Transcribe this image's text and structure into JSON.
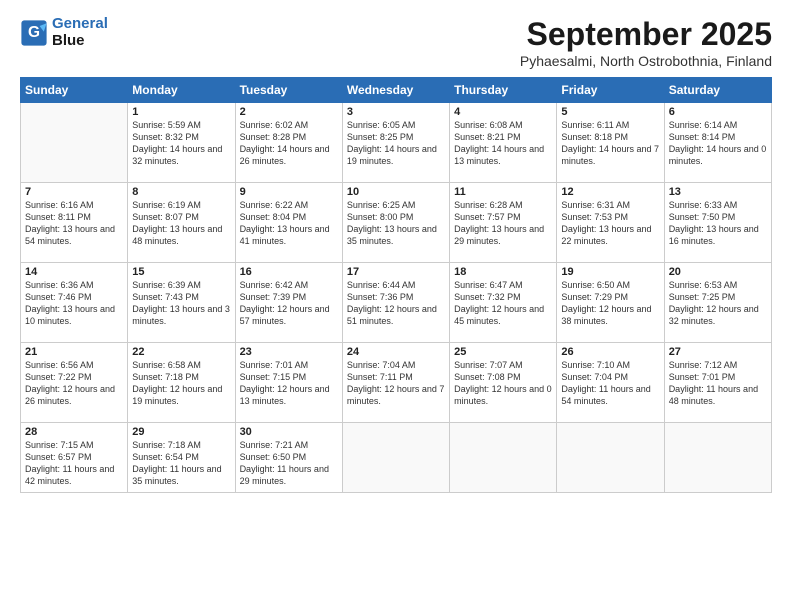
{
  "header": {
    "logo_line1": "General",
    "logo_line2": "Blue",
    "title": "September 2025",
    "subtitle": "Pyhaesalmi, North Ostrobothnia, Finland"
  },
  "days_of_week": [
    "Sunday",
    "Monday",
    "Tuesday",
    "Wednesday",
    "Thursday",
    "Friday",
    "Saturday"
  ],
  "weeks": [
    [
      {
        "num": "",
        "sunrise": "",
        "sunset": "",
        "daylight": ""
      },
      {
        "num": "1",
        "sunrise": "Sunrise: 5:59 AM",
        "sunset": "Sunset: 8:32 PM",
        "daylight": "Daylight: 14 hours and 32 minutes."
      },
      {
        "num": "2",
        "sunrise": "Sunrise: 6:02 AM",
        "sunset": "Sunset: 8:28 PM",
        "daylight": "Daylight: 14 hours and 26 minutes."
      },
      {
        "num": "3",
        "sunrise": "Sunrise: 6:05 AM",
        "sunset": "Sunset: 8:25 PM",
        "daylight": "Daylight: 14 hours and 19 minutes."
      },
      {
        "num": "4",
        "sunrise": "Sunrise: 6:08 AM",
        "sunset": "Sunset: 8:21 PM",
        "daylight": "Daylight: 14 hours and 13 minutes."
      },
      {
        "num": "5",
        "sunrise": "Sunrise: 6:11 AM",
        "sunset": "Sunset: 8:18 PM",
        "daylight": "Daylight: 14 hours and 7 minutes."
      },
      {
        "num": "6",
        "sunrise": "Sunrise: 6:14 AM",
        "sunset": "Sunset: 8:14 PM",
        "daylight": "Daylight: 14 hours and 0 minutes."
      }
    ],
    [
      {
        "num": "7",
        "sunrise": "Sunrise: 6:16 AM",
        "sunset": "Sunset: 8:11 PM",
        "daylight": "Daylight: 13 hours and 54 minutes."
      },
      {
        "num": "8",
        "sunrise": "Sunrise: 6:19 AM",
        "sunset": "Sunset: 8:07 PM",
        "daylight": "Daylight: 13 hours and 48 minutes."
      },
      {
        "num": "9",
        "sunrise": "Sunrise: 6:22 AM",
        "sunset": "Sunset: 8:04 PM",
        "daylight": "Daylight: 13 hours and 41 minutes."
      },
      {
        "num": "10",
        "sunrise": "Sunrise: 6:25 AM",
        "sunset": "Sunset: 8:00 PM",
        "daylight": "Daylight: 13 hours and 35 minutes."
      },
      {
        "num": "11",
        "sunrise": "Sunrise: 6:28 AM",
        "sunset": "Sunset: 7:57 PM",
        "daylight": "Daylight: 13 hours and 29 minutes."
      },
      {
        "num": "12",
        "sunrise": "Sunrise: 6:31 AM",
        "sunset": "Sunset: 7:53 PM",
        "daylight": "Daylight: 13 hours and 22 minutes."
      },
      {
        "num": "13",
        "sunrise": "Sunrise: 6:33 AM",
        "sunset": "Sunset: 7:50 PM",
        "daylight": "Daylight: 13 hours and 16 minutes."
      }
    ],
    [
      {
        "num": "14",
        "sunrise": "Sunrise: 6:36 AM",
        "sunset": "Sunset: 7:46 PM",
        "daylight": "Daylight: 13 hours and 10 minutes."
      },
      {
        "num": "15",
        "sunrise": "Sunrise: 6:39 AM",
        "sunset": "Sunset: 7:43 PM",
        "daylight": "Daylight: 13 hours and 3 minutes."
      },
      {
        "num": "16",
        "sunrise": "Sunrise: 6:42 AM",
        "sunset": "Sunset: 7:39 PM",
        "daylight": "Daylight: 12 hours and 57 minutes."
      },
      {
        "num": "17",
        "sunrise": "Sunrise: 6:44 AM",
        "sunset": "Sunset: 7:36 PM",
        "daylight": "Daylight: 12 hours and 51 minutes."
      },
      {
        "num": "18",
        "sunrise": "Sunrise: 6:47 AM",
        "sunset": "Sunset: 7:32 PM",
        "daylight": "Daylight: 12 hours and 45 minutes."
      },
      {
        "num": "19",
        "sunrise": "Sunrise: 6:50 AM",
        "sunset": "Sunset: 7:29 PM",
        "daylight": "Daylight: 12 hours and 38 minutes."
      },
      {
        "num": "20",
        "sunrise": "Sunrise: 6:53 AM",
        "sunset": "Sunset: 7:25 PM",
        "daylight": "Daylight: 12 hours and 32 minutes."
      }
    ],
    [
      {
        "num": "21",
        "sunrise": "Sunrise: 6:56 AM",
        "sunset": "Sunset: 7:22 PM",
        "daylight": "Daylight: 12 hours and 26 minutes."
      },
      {
        "num": "22",
        "sunrise": "Sunrise: 6:58 AM",
        "sunset": "Sunset: 7:18 PM",
        "daylight": "Daylight: 12 hours and 19 minutes."
      },
      {
        "num": "23",
        "sunrise": "Sunrise: 7:01 AM",
        "sunset": "Sunset: 7:15 PM",
        "daylight": "Daylight: 12 hours and 13 minutes."
      },
      {
        "num": "24",
        "sunrise": "Sunrise: 7:04 AM",
        "sunset": "Sunset: 7:11 PM",
        "daylight": "Daylight: 12 hours and 7 minutes."
      },
      {
        "num": "25",
        "sunrise": "Sunrise: 7:07 AM",
        "sunset": "Sunset: 7:08 PM",
        "daylight": "Daylight: 12 hours and 0 minutes."
      },
      {
        "num": "26",
        "sunrise": "Sunrise: 7:10 AM",
        "sunset": "Sunset: 7:04 PM",
        "daylight": "Daylight: 11 hours and 54 minutes."
      },
      {
        "num": "27",
        "sunrise": "Sunrise: 7:12 AM",
        "sunset": "Sunset: 7:01 PM",
        "daylight": "Daylight: 11 hours and 48 minutes."
      }
    ],
    [
      {
        "num": "28",
        "sunrise": "Sunrise: 7:15 AM",
        "sunset": "Sunset: 6:57 PM",
        "daylight": "Daylight: 11 hours and 42 minutes."
      },
      {
        "num": "29",
        "sunrise": "Sunrise: 7:18 AM",
        "sunset": "Sunset: 6:54 PM",
        "daylight": "Daylight: 11 hours and 35 minutes."
      },
      {
        "num": "30",
        "sunrise": "Sunrise: 7:21 AM",
        "sunset": "Sunset: 6:50 PM",
        "daylight": "Daylight: 11 hours and 29 minutes."
      },
      {
        "num": "",
        "sunrise": "",
        "sunset": "",
        "daylight": ""
      },
      {
        "num": "",
        "sunrise": "",
        "sunset": "",
        "daylight": ""
      },
      {
        "num": "",
        "sunrise": "",
        "sunset": "",
        "daylight": ""
      },
      {
        "num": "",
        "sunrise": "",
        "sunset": "",
        "daylight": ""
      }
    ]
  ]
}
